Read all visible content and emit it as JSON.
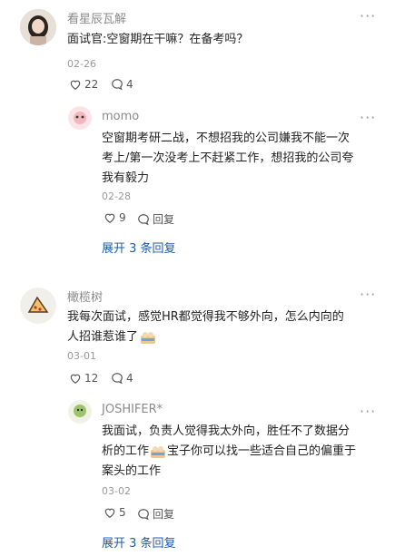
{
  "comments": [
    {
      "author": "看星辰瓦解",
      "text": "面试官:空窗期在干嘛？在备考吗？",
      "date": "02-26",
      "likes": "22",
      "replies": "4",
      "reply": {
        "author": "momo",
        "text_lines": [
          "空窗期考研二战，不想招我的公司嫌我不能一次",
          "考上/第一次没考上不赶紧工作，想招我的公司夸",
          "我有毅力"
        ],
        "date": "02-28",
        "likes": "9",
        "reply_label": "回复"
      },
      "expand_label": "展开 3 条回复"
    },
    {
      "author": "橄榄树",
      "text_lines": [
        "我每次面试，感觉HR都觉得我不够外向，怎么内向的",
        "人招谁惹谁了"
      ],
      "date": "03-01",
      "likes": "12",
      "replies": "4",
      "reply": {
        "author": "JOSHIFER*",
        "text_lines": [
          "我面试，负责人觉得我太外向，胜任不了数据分",
          "析的工作",
          "宝子你可以找一些适合自己的偏重于",
          "案头的工作"
        ],
        "date": "03-02",
        "likes": "5",
        "reply_label": "回复"
      },
      "expand_label": "展开 3 条回复"
    }
  ],
  "more_glyph": "···"
}
